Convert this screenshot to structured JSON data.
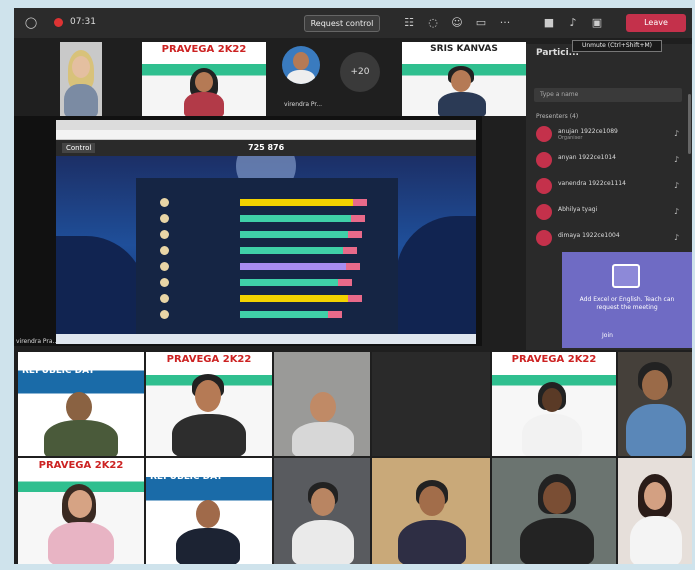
{
  "topbar": {
    "timer": "07:31",
    "request_control_label": "Request control",
    "leave_label": "Leave",
    "icons": [
      "shield-icon",
      "record-icon",
      "people-icon",
      "chat-icon",
      "reactions-icon",
      "share-icon",
      "more-icon",
      "camera-icon",
      "mic-icon",
      "speaker-icon"
    ]
  },
  "upper_row": {
    "poster_left_title": "PRAVEGA 2K22",
    "poster_right_title": "SRIS KANVAS",
    "attendee_name": "virendra Pr...",
    "overflow_label": "+20"
  },
  "share": {
    "presenter_label": "virendra Pra...",
    "quiz_control_label": "Control",
    "quiz_code": "725 876",
    "leaderboard": [
      {
        "fill": 0.9,
        "color": "#f2d200"
      },
      {
        "fill": 0.88,
        "color": "#3fd0a8"
      },
      {
        "fill": 0.86,
        "color": "#3fd0a8"
      },
      {
        "fill": 0.82,
        "color": "#3fd0a8"
      },
      {
        "fill": 0.84,
        "color": "#a88df0"
      },
      {
        "fill": 0.78,
        "color": "#3fd0a8"
      },
      {
        "fill": 0.86,
        "color": "#f2d200"
      },
      {
        "fill": 0.7,
        "color": "#3fd0a8"
      }
    ]
  },
  "panel": {
    "title": "Partici...",
    "tooltip": "Unmute (Ctrl+Shift+M)",
    "search_placeholder": "Type a name",
    "presenters_label": "Presenters (4)",
    "people": [
      {
        "name": "anujan 1922ce1089",
        "role": "Organiser"
      },
      {
        "name": "anyan 1922ce1014",
        "role": ""
      },
      {
        "name": "vanendra 1922ce1114",
        "role": ""
      },
      {
        "name": "Abhilya tyagi",
        "role": ""
      },
      {
        "name": "dimaya 1922ce1004",
        "role": ""
      }
    ],
    "popup_text": "Add Excel or English. Teach can request the meeting",
    "popup_button": "Join"
  },
  "bottom_grid": {
    "republic_day_label": "REPUBLIC DAY",
    "pravega_label": "PRAVEGA 2K22",
    "republic_day_label_2": "REPUBLIC DAY"
  },
  "colors": {
    "leave": "#c4314b",
    "popup": "#6f6bc4",
    "accent_green": "#2fbf8f"
  }
}
